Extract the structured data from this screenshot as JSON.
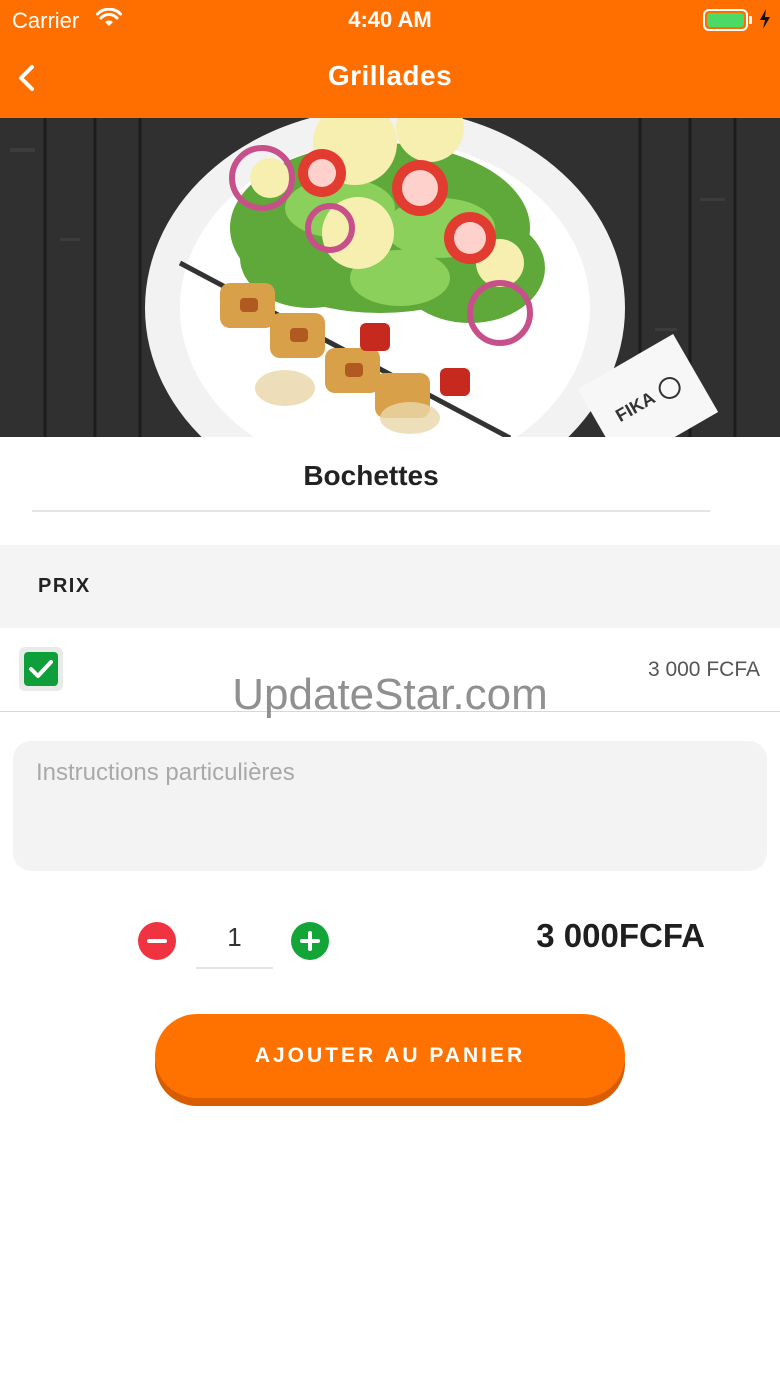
{
  "status_bar": {
    "carrier": "Carrier",
    "time": "4:40 AM"
  },
  "nav": {
    "title": "Grillades"
  },
  "product": {
    "name": "Bochettes"
  },
  "price_section": {
    "label": "PRIX",
    "option_price": "3 000 FCFA",
    "option_checked": true
  },
  "watermark": "UpdateStar.com",
  "instructions": {
    "placeholder": "Instructions particulières",
    "value": ""
  },
  "quantity": {
    "value": "1",
    "total": "3 000FCFA"
  },
  "cta": {
    "label": "AJOUTER AU PANIER"
  },
  "colors": {
    "brand_orange": "#ff6f00",
    "check_green": "#0e9f3a",
    "minus_red": "#ef3340",
    "plus_green": "#13a538"
  },
  "icons": [
    "wifi-icon",
    "battery-icon",
    "back-chevron-icon",
    "checkmark-icon",
    "minus-icon",
    "plus-icon"
  ]
}
